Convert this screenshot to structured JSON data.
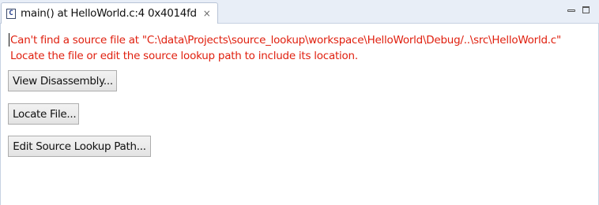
{
  "tab": {
    "title": "main() at HelloWorld.c:4 0x4014fd",
    "icon_name": "c-source-file-icon",
    "close_glyph": "×"
  },
  "message": {
    "line1": "Can't find a source file at \"C:\\data\\Projects\\source_lookup\\workspace\\HelloWorld\\Debug/..\\src\\HelloWorld.c\"",
    "line2": "Locate the file or edit the source lookup path to include its location.",
    "color": "#e0200f"
  },
  "buttons": {
    "view_disassembly": "View Disassembly...",
    "locate_file": "Locate File...",
    "edit_lookup_path": "Edit Source Lookup Path..."
  }
}
